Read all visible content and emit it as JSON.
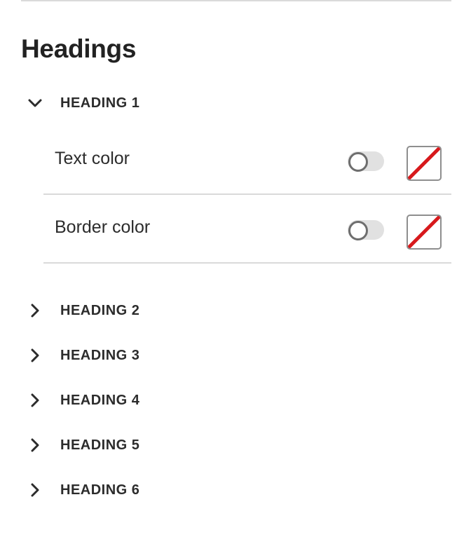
{
  "panel": {
    "title": "Headings"
  },
  "accordion": [
    {
      "label": "HEADING 1",
      "expanded": true,
      "icon": "chevron-down-icon",
      "rows": [
        {
          "label": "Text color",
          "toggle_on": false,
          "swatch": "none"
        },
        {
          "label": "Border color",
          "toggle_on": false,
          "swatch": "none"
        }
      ]
    },
    {
      "label": "HEADING 2",
      "expanded": false,
      "icon": "chevron-right-icon"
    },
    {
      "label": "HEADING 3",
      "expanded": false,
      "icon": "chevron-right-icon"
    },
    {
      "label": "HEADING 4",
      "expanded": false,
      "icon": "chevron-right-icon"
    },
    {
      "label": "HEADING 5",
      "expanded": false,
      "icon": "chevron-right-icon"
    },
    {
      "label": "HEADING 6",
      "expanded": false,
      "icon": "chevron-right-icon"
    }
  ],
  "colors": {
    "no_color_slash": "#d7191c",
    "toggle_track_off": "#e1e1e1",
    "divider": "#dadada"
  }
}
